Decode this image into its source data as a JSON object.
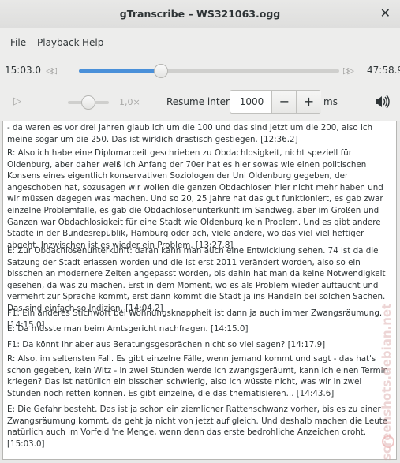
{
  "window": {
    "title": "gTranscribe – WS321063.ogg"
  },
  "menu": [
    "File",
    "Playback",
    "Help"
  ],
  "player": {
    "position": "15:03.0",
    "duration": "47:58.9",
    "progress_fraction": 0.3137,
    "speed_label": "1,0×",
    "speed_fraction": 0.5,
    "resume_label": "Resume interval:",
    "resume_value": "1000",
    "resume_unit": "ms",
    "minus": "−",
    "plus": "+"
  },
  "transcript": [
    "- da waren es vor drei Jahren glaub ich um die 100 und das sind jetzt um die 200, also ich meine sogar um die 250. Das ist wirklich drastisch gestiegen.  [12:36.2]",
    "R: Also ich habe eine Diplomarbeit geschrieben zu Obdachlosigkeit, nicht speziell für Oldenburg, aber daher weiß ich Anfang der 70er hat es hier sowas wie einen politischen Konsens eines eigentlich konservativen Soziologen der Uni Oldenburg gegeben, der angeschoben hat, sozusagen wir wollen die ganzen Obdachlosen hier nicht mehr haben und wir müssen dagegen was machen. Und so 20, 25 Jahre hat das gut funktioniert, es gab zwar einzelne Problemfälle, es gab die Obdachlosenunterkunft im Sandweg, aber im Großen und Ganzen war Obdachlosigkeit für eine Stadt wie Oldenburg kein Problem. Und es gibt andere Städte in der Bundesrepublik, Hamburg oder ach, viele andere, wo das viel viel heftiger abgeht. Inzwischen ist es wieder ein Problem.  [13:27.8]",
    "E: Zur Obdachlosenunterkunft: daran kann man auch eine Entwicklung sehen. 74 ist da die Satzung der Stadt erlassen worden und die ist erst 2011 verändert worden, also so ein bisschen an modernere Zeiten angepasst worden, bis dahin hat man da keine Notwendigkeit gesehen, da was zu machen. Erst in dem Moment, wo es als Problem wieder auftaucht und vermehrt zur Sprache kommt, erst dann kommt die Stadt ja ins Handeln bei solchen Sachen. Das sind einfach so Indizien. [14:04.2]",
    "F1: Ein anderes Stichwort bei Wohnungsknappheit ist dann ja auch immer Zwangsräumung. [14:15.0]",
    "E: Da müsste man beim Amtsgericht nachfragen. [14:15.0]",
    "F1:  Da könnt ihr aber aus Beratungsgesprächen nicht so viel sagen? [14:17.9]",
    "R: Also, im seltensten Fall. Es gibt einzelne Fälle, wenn jemand kommt und sagt - das hat's schon gegeben, kein Witz - in zwei Stunden werde ich zwangsgeräumt, kann ich einen Termin kriegen? Das ist natürlich ein bisschen schwierig, also ich wüsste nicht, was wir in zwei Stunden noch retten können. Es gibt einzelne, die das thematisieren... [14:43.6]",
    "E: Die Gefahr besteht. Das ist ja schon ein ziemlicher Rattenschwanz vorher, bis es zu einer Zwangsräumung kommt, da geht ja nicht von jetzt auf gleich. Und deshalb machen die Leute natürlich auch im Vorfeld 'ne Menge, wenn denn das erste bedrohliche Anzeichen droht. [15:03.0]"
  ],
  "watermark": "screenshots.debian.net"
}
